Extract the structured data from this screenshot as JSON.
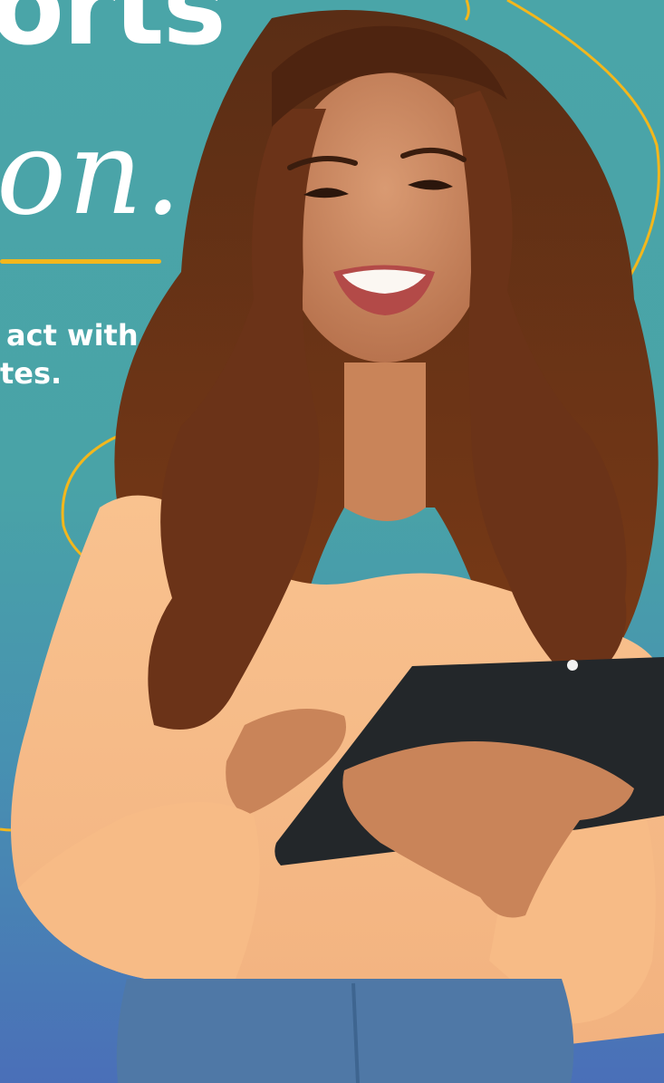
{
  "headline": {
    "word_fragment": "orts",
    "script_fragment": "on",
    "script_dot": "."
  },
  "subtext": {
    "line1": "act with",
    "line2": "tes."
  },
  "colors": {
    "background_teal": "#4aa5a8",
    "background_blue": "#4a6fb8",
    "accent_yellow": "#f3b71c",
    "text": "#ffffff"
  }
}
